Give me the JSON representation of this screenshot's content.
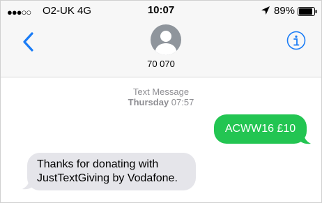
{
  "status_bar": {
    "signal": "●●●○○",
    "carrier": "O2-UK  4G",
    "time": "10:07",
    "battery": "89%",
    "icons": [
      "location-arrow-icon",
      "battery-icon"
    ]
  },
  "header": {
    "contact": "70 070",
    "back_icon": "chevron-left-icon",
    "info_icon": "info-icon",
    "accent": "#1a7cf6"
  },
  "conversation": {
    "meta_label": "Text Message",
    "meta_day": "Thursday",
    "meta_time": "07:57",
    "messages": [
      {
        "direction": "outgoing",
        "text": "ACWW16 £10",
        "color": "#23c552"
      },
      {
        "direction": "incoming",
        "text": "Thanks for donating with JustTextGiving by Vodafone.",
        "color": "#e5e5ea"
      }
    ]
  }
}
